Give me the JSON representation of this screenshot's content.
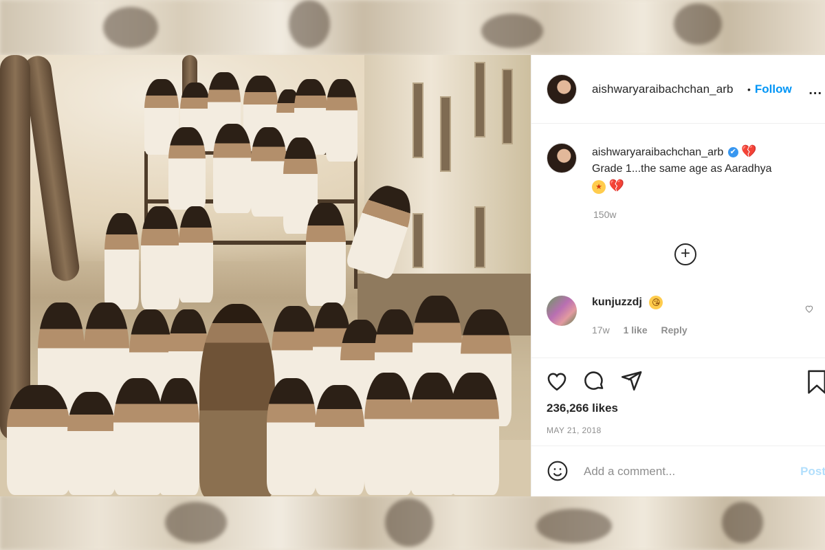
{
  "post": {
    "header": {
      "username": "aishwaryaraibachchan_arb",
      "separator": "•",
      "follow_label": "Follow",
      "more_label": "..."
    },
    "caption": {
      "username": "aishwaryaraibachchan_arb",
      "verified_icon": "✔",
      "heart_emoji": "💔",
      "text": "Grade 1...the same age as Aaradhya",
      "emoji_star": "★",
      "emoji_heart": "💔",
      "time": "150w"
    },
    "load_more_icon": "+",
    "comment": {
      "username": "kunjuzzdj",
      "wink_emoji": "😘",
      "time": "17w",
      "likes": "1 like",
      "reply_label": "Reply"
    },
    "actions": {
      "likes": "236,266 likes",
      "date": "MAY 21, 2018"
    },
    "add_comment": {
      "placeholder": "Add a comment...",
      "post_label": "Post"
    }
  },
  "colors": {
    "accent": "#0095f6",
    "muted": "#8e8e8e",
    "text": "#262626"
  }
}
